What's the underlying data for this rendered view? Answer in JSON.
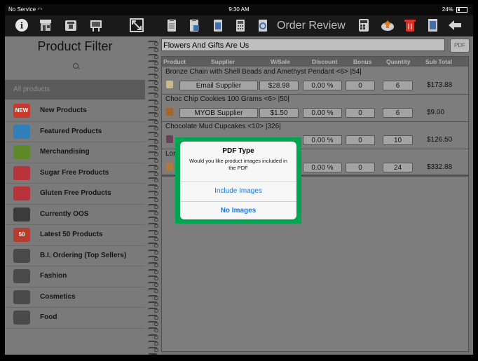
{
  "status_bar": {
    "carrier": "No Service",
    "time": "9:30 AM",
    "battery": "24%"
  },
  "toolbar": {
    "title": "Order Review",
    "left_icons": [
      "info-icon",
      "store-icon",
      "delivery-icon",
      "presentation-icon",
      "resize-icon"
    ],
    "right_icons": [
      "clipboard-icon",
      "clipboard-check-icon",
      "clipboard-list-icon",
      "calculator-icon",
      "clipboard-refresh-icon",
      "calculator-dark-icon",
      "cloud-upload-icon",
      "trash-icon",
      "document-icon",
      "back-arrow-icon"
    ]
  },
  "product_filter": {
    "title": "Product Filter",
    "all_products": "All products",
    "categories": [
      {
        "label": "New Products",
        "icon": "new-badge-icon",
        "color": "#c8392c",
        "badge": "NEW"
      },
      {
        "label": "Featured Products",
        "icon": "tag-icon",
        "color": "#2f7fb8",
        "badge": ""
      },
      {
        "label": "Merchandising",
        "icon": "bag-icon",
        "color": "#5c8a28",
        "badge": ""
      },
      {
        "label": "Sugar Free Products",
        "icon": "pin-icon",
        "color": "#b8333a",
        "badge": ""
      },
      {
        "label": "Gluten Free Products",
        "icon": "pin-icon",
        "color": "#b8333a",
        "badge": ""
      },
      {
        "label": "Currently OOS",
        "icon": "speedometer-icon",
        "color": "#3b3b3b",
        "badge": ""
      },
      {
        "label": "Latest 50 Products",
        "icon": "calendar-icon",
        "color": "#b63c2d",
        "badge": "50"
      },
      {
        "label": "B.I. Ordering (Top Sellers)",
        "icon": "bar-chart-icon",
        "color": "#4a4a4a",
        "badge": ""
      },
      {
        "label": "Fashion",
        "icon": "box-icon",
        "color": "#4a4a4a",
        "badge": ""
      },
      {
        "label": "Cosmetics",
        "icon": "box-icon",
        "color": "#4a4a4a",
        "badge": ""
      },
      {
        "label": "Food",
        "icon": "box-icon",
        "color": "#4a4a4a",
        "badge": ""
      }
    ]
  },
  "order": {
    "supplier_name": "Flowers And Gifts Are Us",
    "pdf_button": "PDF",
    "columns": [
      "Product",
      "Supplier",
      "W/Sale",
      "Discount",
      "Bonus",
      "Quantity",
      "Sub Total"
    ],
    "rows": [
      {
        "name": "Bronze Chain with Shell Beads and Amethyst Pendant <6> |54|",
        "supplier": "Email Supplier",
        "wsale": "$28.98",
        "discount": "0.00 %",
        "bonus": "0",
        "quantity": "6",
        "subtotal": "$173.88",
        "thumb_color": "#c9b98a"
      },
      {
        "name": "Choc Chip Cookies 100 Grams <6> |50|",
        "supplier": "MYOB Supplier",
        "wsale": "$1.50",
        "discount": "0.00 %",
        "bonus": "0",
        "quantity": "6",
        "subtotal": "$9.00",
        "thumb_color": "#a5652a"
      },
      {
        "name": "Chocolate Mud Cupcakes <10> |326|",
        "supplier": "",
        "wsale": "",
        "discount": "0.00 %",
        "bonus": "0",
        "quantity": "10",
        "subtotal": "$126.50",
        "thumb_color": "#6b3f55"
      },
      {
        "name": "Lor",
        "supplier": "",
        "wsale": "",
        "discount": "0.00 %",
        "bonus": "0",
        "quantity": "24",
        "subtotal": "$332.88",
        "thumb_color": "#b07a3a"
      }
    ]
  },
  "dialog": {
    "title": "PDF Type",
    "message": "Would you like product images included in the PDF",
    "include_button": "Include Images",
    "no_images_button": "No Images",
    "highlight_color": "#00a551",
    "button_color": "#1f7ae0"
  }
}
